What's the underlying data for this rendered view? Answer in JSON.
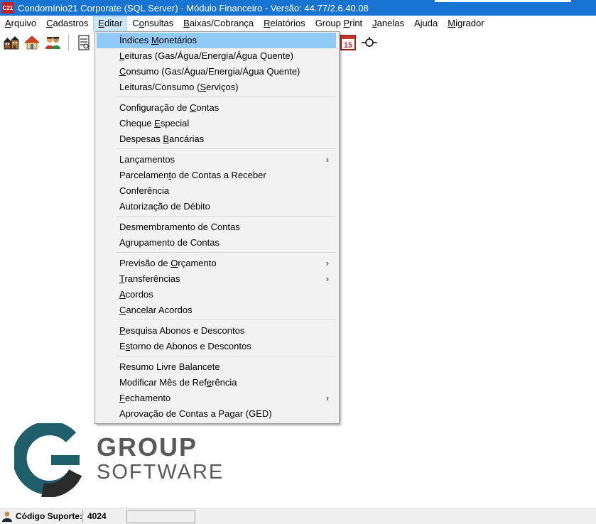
{
  "window": {
    "app_icon_text": "C21",
    "title": "Condomínio21 Corporate  (SQL Server)  - Módulo Financeiro - Versão: 44.77/2.6.40.08"
  },
  "menubar": [
    {
      "label": "Arquivo",
      "key": "A",
      "rest": "rquivo"
    },
    {
      "label": "Cadastros",
      "key": "C",
      "rest": "adastros"
    },
    {
      "label": "Editar",
      "key": "E",
      "rest": "ditar"
    },
    {
      "label": "Consultas",
      "pre": "C",
      "key": "o",
      "rest": "nsultas"
    },
    {
      "label": "Baixas/Cobrança",
      "key": "B",
      "rest": "aixas/Cobrança"
    },
    {
      "label": "Relatórios",
      "key": "R",
      "rest": "elatórios"
    },
    {
      "label": "Group Print",
      "pre": "Group ",
      "key": "P",
      "rest": "rint"
    },
    {
      "label": "Janelas",
      "key": "J",
      "rest": "anelas"
    },
    {
      "label": "Ajuda",
      "pre": "A",
      "key": "j",
      "rest": "uda"
    },
    {
      "label": "Migrador",
      "key": "M",
      "rest": "igrador"
    }
  ],
  "toolbar": {
    "icons": [
      "buildings-icon",
      "house-icon",
      "people-icon",
      "document-icon",
      "calendar-icon",
      "reconnect-icon"
    ],
    "calendar_day": "15"
  },
  "edit_menu": {
    "items": [
      {
        "pre": "Índices ",
        "key": "M",
        "rest": "onetários",
        "highlighted": true
      },
      {
        "pre": "",
        "key": "L",
        "rest": "eituras (Gas/Água/Energia/Água Quente)"
      },
      {
        "pre": "",
        "key": "C",
        "rest": "onsumo (Gas/Água/Energia/Água Quente)"
      },
      {
        "pre": "Leituras/Consumo (",
        "key": "S",
        "rest": "erviços)"
      },
      {
        "pre": "Configuração de ",
        "key": "C",
        "rest": "ontas"
      },
      {
        "pre": "Cheque ",
        "key": "E",
        "rest": "special"
      },
      {
        "pre": "Despesas ",
        "key": "B",
        "rest": "ancárias"
      },
      {
        "pre": "Lançamentos",
        "key": "",
        "rest": "",
        "submenu": true
      },
      {
        "pre": "Parcelamen",
        "key": "t",
        "rest": "o de Contas a Receber"
      },
      {
        "pre": "Conferência",
        "key": "",
        "rest": ""
      },
      {
        "pre": "Autorização de Débito",
        "key": "",
        "rest": ""
      },
      {
        "pre": "Desmembramento de Contas",
        "key": "",
        "rest": ""
      },
      {
        "pre": "Agrupamento de Contas",
        "key": "",
        "rest": ""
      },
      {
        "pre": "Previsão de ",
        "key": "O",
        "rest": "rçamento",
        "submenu": true
      },
      {
        "pre": "",
        "key": "T",
        "rest": "ransferências",
        "submenu": true
      },
      {
        "pre": "",
        "key": "A",
        "rest": "cordos"
      },
      {
        "pre": "",
        "key": "C",
        "rest": "ancelar Acordos"
      },
      {
        "pre": "",
        "key": "P",
        "rest": "esquisa  Abonos e Descontos"
      },
      {
        "pre": "E",
        "key": "s",
        "rest": "torno de Abonos e Descontos"
      },
      {
        "pre": "Resumo Livre Balancete",
        "key": "",
        "rest": ""
      },
      {
        "pre": "Modificar Mês de Ref",
        "key": "e",
        "rest": "rência"
      },
      {
        "pre": "",
        "key": "F",
        "rest": "echamento",
        "submenu": true
      },
      {
        "pre": "Aprovação de Contas a Pagar (GED)",
        "key": "",
        "rest": ""
      }
    ],
    "submenu_arrow": "›"
  },
  "logo": {
    "line1": "GROUP",
    "line2": "SOFTWARE",
    "colors": {
      "teal": "#1f5f6b",
      "dark": "#3a3a3a"
    }
  },
  "statusbar": {
    "label": "Código Suporte:",
    "value": "4024"
  },
  "colors": {
    "titlebar": "#1874d2",
    "highlight": "#91c9f7",
    "menu_bg": "#f2f2f2"
  }
}
